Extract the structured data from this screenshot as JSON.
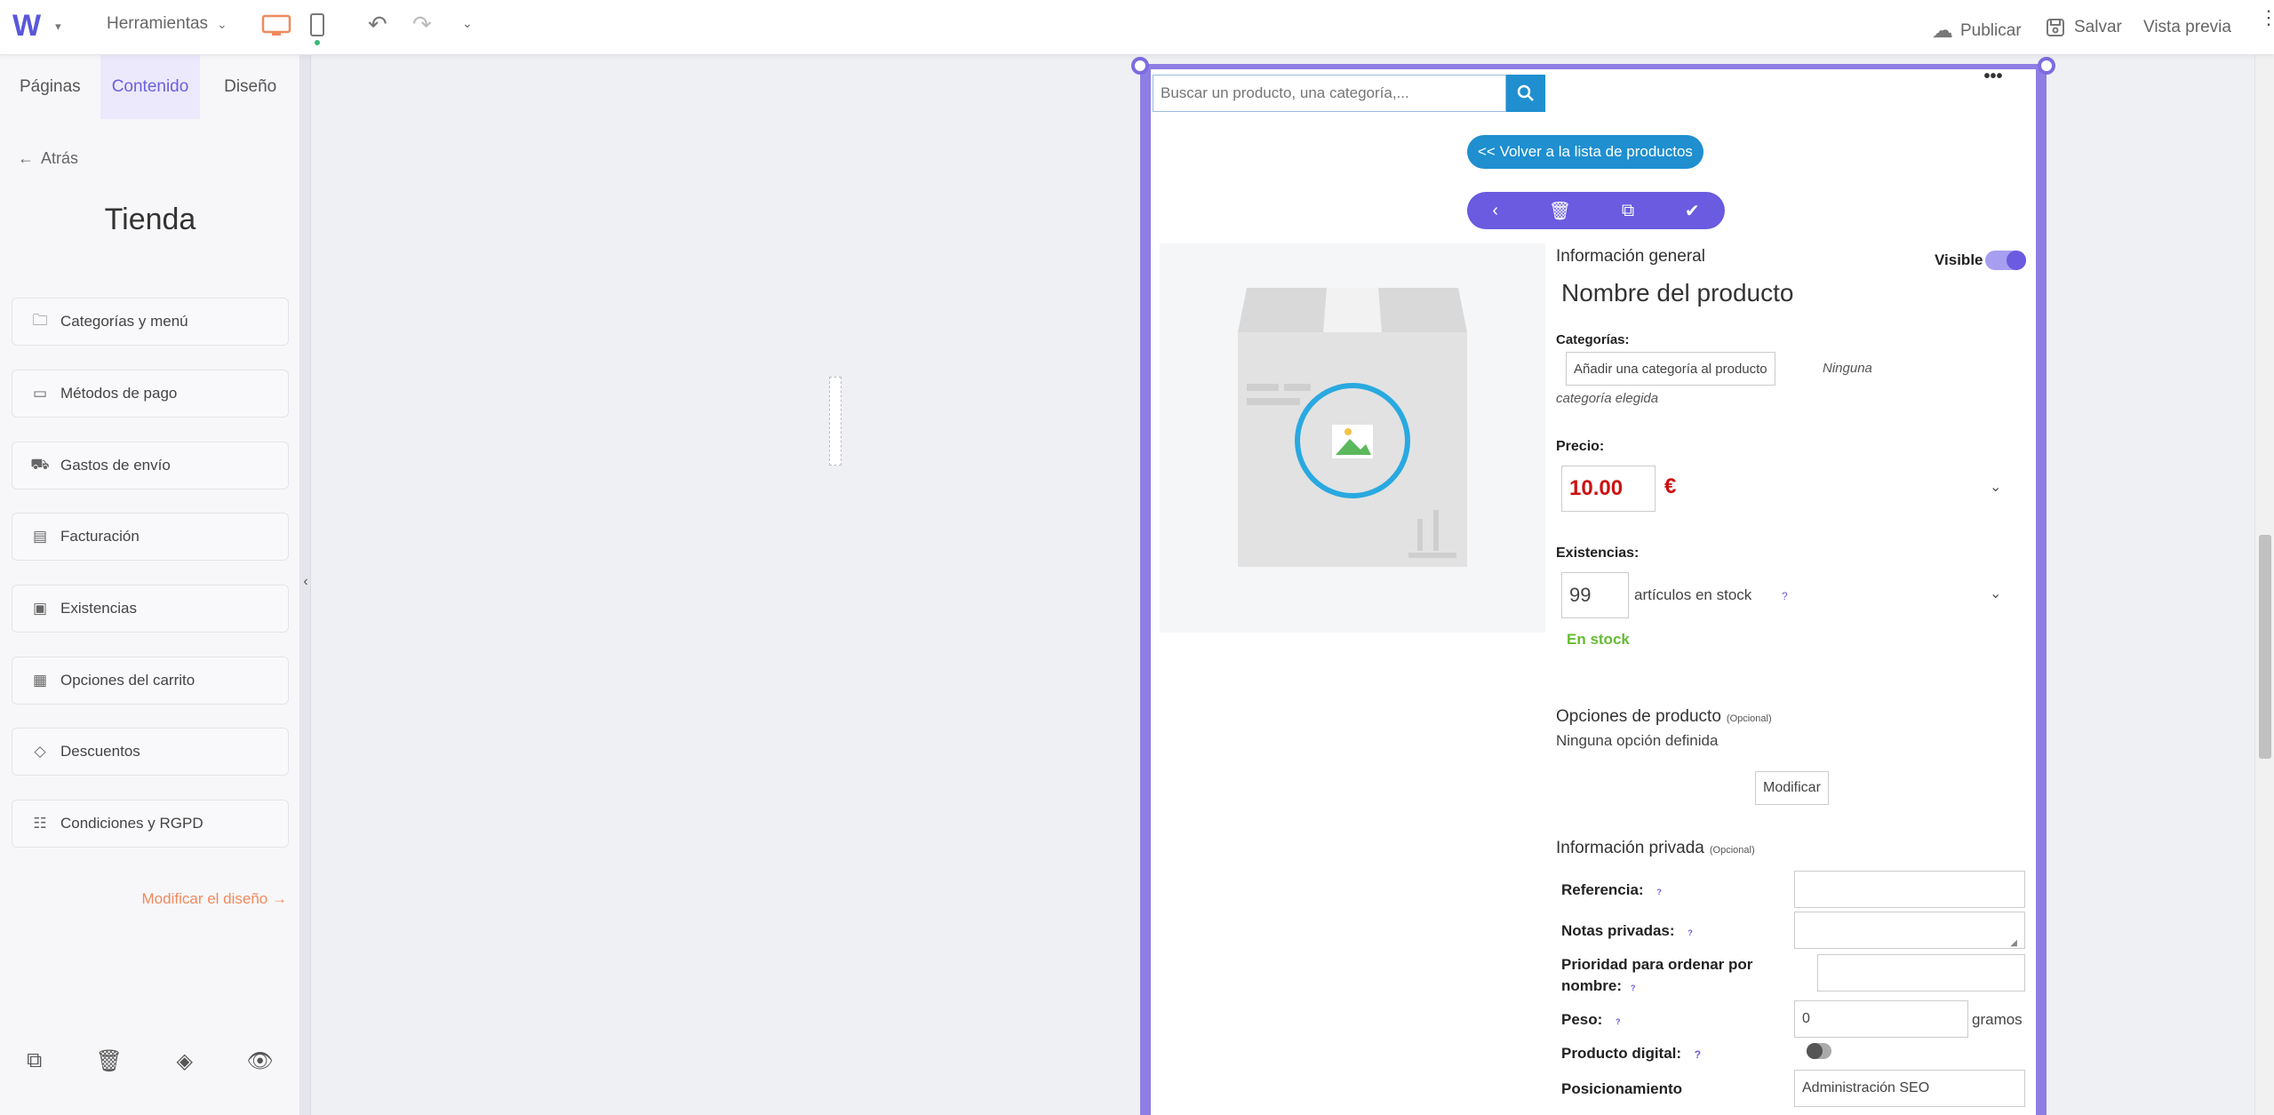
{
  "toolbar": {
    "logo": "W",
    "tools_label": "Herramientas",
    "publish_label": "Publicar",
    "save_label": "Salvar",
    "preview_label": "Vista previa"
  },
  "sidebar": {
    "tabs": [
      {
        "label": "Páginas"
      },
      {
        "label": "Contenido"
      },
      {
        "label": "Diseño"
      }
    ],
    "back_label": "Atrás",
    "title": "Tienda",
    "items": [
      {
        "label": "Categorías y menú",
        "icon": "folder-icon"
      },
      {
        "label": "Métodos de pago",
        "icon": "card-icon"
      },
      {
        "label": "Gastos de envío",
        "icon": "truck-icon"
      },
      {
        "label": "Facturación",
        "icon": "clipboard-icon"
      },
      {
        "label": "Existencias",
        "icon": "box-icon"
      },
      {
        "label": "Opciones del carrito",
        "icon": "grid-icon"
      },
      {
        "label": "Descuentos",
        "icon": "tag-icon"
      },
      {
        "label": "Condiciones y RGPD",
        "icon": "list-icon"
      }
    ],
    "modify_design_label": "Modificar el diseño",
    "accent": "#6d60de"
  },
  "product": {
    "search_placeholder": "Buscar un producto, una categoría,...",
    "back_to_list": "<< Volver a la lista de productos",
    "general_info": "Información general",
    "visible_label": "Visible",
    "visible": true,
    "name": "Nombre del producto",
    "categories_label": "Categorías:",
    "add_category": "Añadir una categoría al producto",
    "no_category_1": "Ninguna",
    "no_category_2": "categoría elegida",
    "price_label": "Precio:",
    "price_value": "10.00",
    "currency": "€",
    "stock_label": "Existencias:",
    "stock_value": "99",
    "stock_unit": "artículos en stock",
    "stock_help": "?",
    "stock_status": "En stock",
    "options_title": "Opciones de producto",
    "options_optional": "(Opcional)",
    "options_none": "Ninguna opción definida",
    "modify_button": "Modificar",
    "private_title": "Información privada",
    "private_optional": "(Opcional)",
    "ref_label": "Referencia:",
    "notes_label": "Notas privadas:",
    "priority_label_1": "Prioridad para ordenar por",
    "priority_label_2": "nombre:",
    "weight_label": "Peso:",
    "weight_value": "0",
    "weight_unit": "gramos",
    "digital_label": "Producto digital:",
    "digital_help": "?",
    "seo_label": "Posicionamiento",
    "seo_button": "Administración SEO",
    "help_mark": "?",
    "price_color": "#cc1111",
    "stock_color": "#66bb33"
  }
}
